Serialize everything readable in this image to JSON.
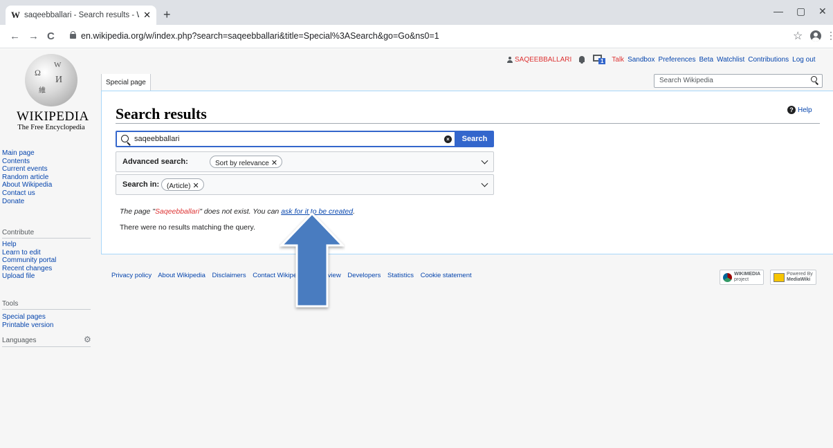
{
  "browser": {
    "tab_favicon": "W",
    "tab_title": "saqeebballari - Search results - Wi",
    "tab_close": "✕",
    "new_tab": "+",
    "window_minimize": "—",
    "window_restore": "▢",
    "window_close": "✕",
    "back": "←",
    "forward": "→",
    "reload": "C",
    "url": "en.wikipedia.org/w/index.php?search=saqeebballari&title=Special%3ASearch&go=Go&ns0=1",
    "bookmark": "☆",
    "menu": "⋮"
  },
  "logo": {
    "wordmark": "WIKIPEDIA",
    "tagline": "The Free Encyclopedia",
    "glyphs": [
      "Ω",
      "W",
      "И",
      "維"
    ]
  },
  "sidebar": {
    "navigation": [
      "Main page",
      "Contents",
      "Current events",
      "Random article",
      "About Wikipedia",
      "Contact us",
      "Donate"
    ],
    "contribute_heading": "Contribute",
    "contribute": [
      "Help",
      "Learn to edit",
      "Community portal",
      "Recent changes",
      "Upload file"
    ],
    "tools_heading": "Tools",
    "tools": [
      "Special pages",
      "Printable version"
    ],
    "languages_heading": "Languages",
    "gear": "⚙"
  },
  "personal": {
    "username": "SAQEEBBALLARI",
    "notice_count": "1",
    "links": [
      "Talk",
      "Sandbox",
      "Preferences",
      "Beta",
      "Watchlist",
      "Contributions",
      "Log out"
    ]
  },
  "tabs": {
    "special_page": "Special page"
  },
  "header_search": {
    "placeholder": "Search Wikipedia"
  },
  "content": {
    "title": "Search results",
    "help_icon": "?",
    "help": "Help",
    "search_value": "saqeebballari",
    "clear_icon": "×",
    "search_button": "Search",
    "advanced_label": "Advanced search:",
    "advanced_chip": "Sort by relevance",
    "search_in_label": "Search in:",
    "search_in_chip": "(Article)",
    "chip_remove": "✕",
    "notice_prefix": "The page \"",
    "notice_page": "Saqeebballari",
    "notice_mid": "\" does not exist. You can ",
    "notice_link": "ask for it to be created",
    "notice_end": ".",
    "no_results": "There were no results matching the query."
  },
  "footer": {
    "links": [
      "Privacy policy",
      "About Wikipedia",
      "Disclaimers",
      "Contact Wikipe",
      "e view",
      "Developers",
      "Statistics",
      "Cookie statement"
    ],
    "wikimedia_badge": "WIKIMEDIA",
    "wikimedia_sub": "project",
    "mediawiki_badge_top": "Powered By",
    "mediawiki_badge": "MediaWiki"
  },
  "colors": {
    "link": "#0645ad",
    "red_link": "#dd3333",
    "progressive": "#3366cc",
    "arrow_fill": "#4a7cc0"
  }
}
